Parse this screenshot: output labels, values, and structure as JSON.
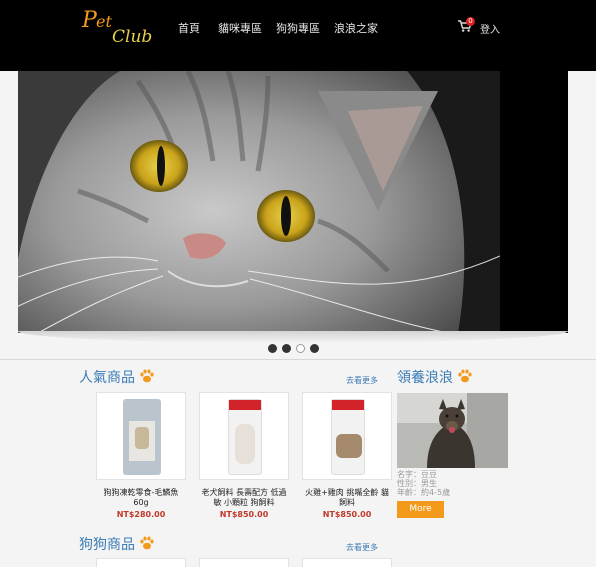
{
  "brand": {
    "p": "P",
    "et": "et",
    "club": "Club"
  },
  "nav": [
    "首頁",
    "貓咪專區",
    "狗狗專區",
    "浪浪之家"
  ],
  "cart": {
    "count": "0"
  },
  "login": "登入",
  "carousel": {
    "slides": 4,
    "active": 2
  },
  "popular": {
    "title": "人氣商品",
    "more": "去看更多",
    "products": [
      {
        "name": "狗狗凍乾零食-毛鱗魚60g",
        "price": "NT$280.00"
      },
      {
        "name": "老犬飼料 長壽配方 低過敏 小顆粒 狗飼料",
        "price": "NT$850.00"
      },
      {
        "name": "火雞+雞肉 挑嘴全齡 貓飼料",
        "price": "NT$850.00"
      }
    ]
  },
  "adopt": {
    "title": "領養浪浪",
    "info": [
      "名字：豆豆",
      "性別：男生",
      "年齡：約4-5歲"
    ],
    "button": "More"
  },
  "dog_section": {
    "title": "狗狗商品",
    "more": "去看更多"
  },
  "colors": {
    "accent": "#f39a1c",
    "link": "#3a7bb5",
    "price": "#c0392b"
  }
}
